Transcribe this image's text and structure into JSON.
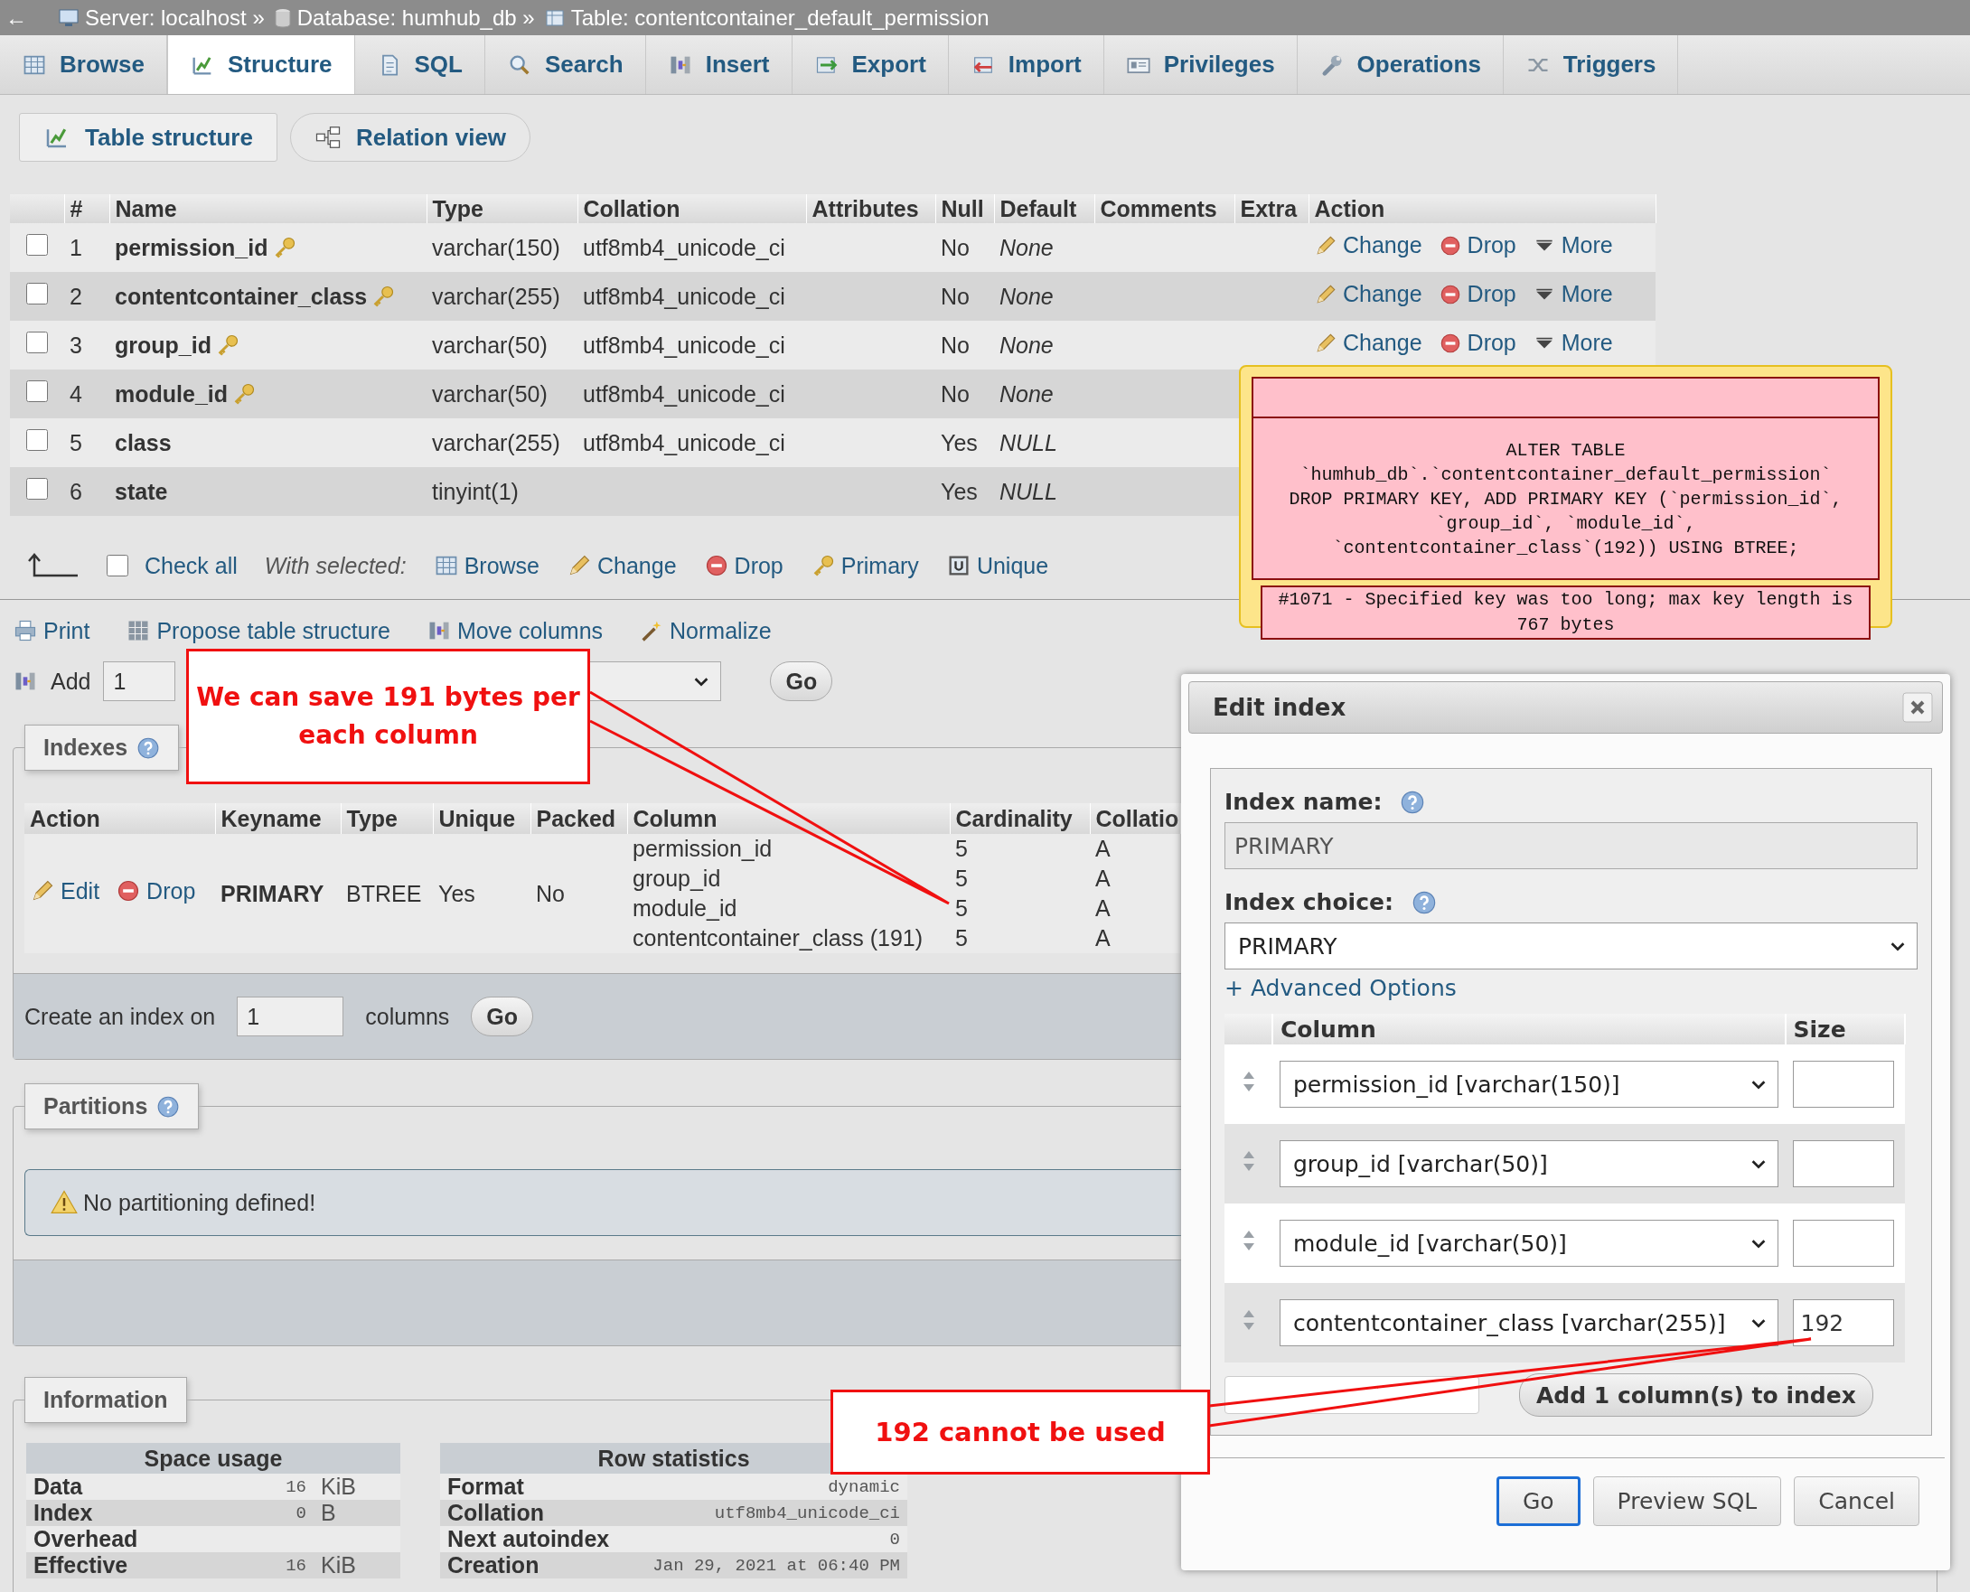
{
  "breadcrumb": {
    "back": "←",
    "items": [
      "Server: localhost »",
      "Database: humhub_db »",
      "Table: contentcontainer_default_permission"
    ]
  },
  "tabs": [
    {
      "label": "Browse",
      "selected": false
    },
    {
      "label": "Structure",
      "selected": true
    },
    {
      "label": "SQL",
      "selected": false
    },
    {
      "label": "Search",
      "selected": false
    },
    {
      "label": "Insert",
      "selected": false
    },
    {
      "label": "Export",
      "selected": false
    },
    {
      "label": "Import",
      "selected": false
    },
    {
      "label": "Privileges",
      "selected": false
    },
    {
      "label": "Operations",
      "selected": false
    },
    {
      "label": "Triggers",
      "selected": false
    }
  ],
  "subtabs": [
    {
      "label": "Table structure",
      "selected": true
    },
    {
      "label": "Relation view",
      "selected": false
    }
  ],
  "structure_table": {
    "headers": [
      "#",
      "Name",
      "Type",
      "Collation",
      "Attributes",
      "Null",
      "Default",
      "Comments",
      "Extra",
      "Action"
    ],
    "rows": [
      {
        "checked": false,
        "num": "1",
        "name": "permission_id",
        "primary_key": true,
        "type": "varchar(150)",
        "collation": "utf8mb4_unicode_ci",
        "null": "No",
        "default": "None",
        "actions": [
          "Change",
          "Drop",
          "More"
        ]
      },
      {
        "checked": false,
        "num": "2",
        "name": "contentcontainer_class",
        "primary_key": true,
        "type": "varchar(255)",
        "collation": "utf8mb4_unicode_ci",
        "null": "No",
        "default": "None",
        "actions": [
          "Change",
          "Drop",
          "More"
        ]
      },
      {
        "checked": false,
        "num": "3",
        "name": "group_id",
        "primary_key": true,
        "type": "varchar(50)",
        "collation": "utf8mb4_unicode_ci",
        "null": "No",
        "default": "None",
        "actions": [
          "Change",
          "Drop",
          "More"
        ]
      },
      {
        "checked": false,
        "num": "4",
        "name": "module_id",
        "primary_key": true,
        "type": "varchar(50)",
        "collation": "utf8mb4_unicode_ci",
        "null": "No",
        "default": "None"
      },
      {
        "checked": false,
        "num": "5",
        "name": "class",
        "primary_key": false,
        "type": "varchar(255)",
        "collation": "utf8mb4_unicode_ci",
        "null": "Yes",
        "default": "NULL"
      },
      {
        "checked": false,
        "num": "6",
        "name": "state",
        "primary_key": false,
        "type": "tinyint(1)",
        "null": "Yes",
        "default": "NULL"
      }
    ]
  },
  "bulk": {
    "check_all": {
      "label": "Check all",
      "checked": false
    },
    "with_selected": "With selected:",
    "actions": [
      "Browse",
      "Change",
      "Drop",
      "Primary",
      "Unique"
    ]
  },
  "toolbar": [
    "Print",
    "Propose table structure",
    "Move columns",
    "Normalize"
  ],
  "add_columns": {
    "label": "Add",
    "value": "1",
    "button": "Go"
  },
  "indexes": {
    "legend": "Indexes",
    "headers": [
      "Action",
      "Keyname",
      "Type",
      "Unique",
      "Packed",
      "Column",
      "Cardinality",
      "Collatio"
    ],
    "row": {
      "actions": [
        "Edit",
        "Drop"
      ],
      "keyname": "PRIMARY",
      "type": "BTREE",
      "unique": "Yes",
      "packed": "No",
      "columns": [
        {
          "column": "permission_id",
          "cardinality": "5",
          "collation": "A"
        },
        {
          "column": "group_id",
          "cardinality": "5",
          "collation": "A"
        },
        {
          "column": "module_id",
          "cardinality": "5",
          "collation": "A"
        },
        {
          "column": "contentcontainer_class (191)",
          "cardinality": "5",
          "collation": "A"
        }
      ]
    },
    "create": {
      "label": "Create an index on",
      "value": "1",
      "unit": "columns",
      "button": "Go"
    }
  },
  "partitions": {
    "legend": "Partitions",
    "message": "No partitioning defined!"
  },
  "information": {
    "legend": "Information",
    "space_usage": {
      "title": "Space usage",
      "rows": [
        {
          "label": "Data",
          "value": "16",
          "unit": "KiB"
        },
        {
          "label": "Index",
          "value": "0",
          "unit": "B"
        },
        {
          "label": "Overhead"
        },
        {
          "label": "Effective",
          "value": "16",
          "unit": "KiB"
        }
      ]
    },
    "row_statistics": {
      "title": "Row statistics",
      "rows": [
        {
          "label": "Format",
          "value": "dynamic"
        },
        {
          "label": "Collation",
          "value": "utf8mb4_unicode_ci"
        },
        {
          "label": "Next autoindex",
          "value": "0"
        },
        {
          "label": "Creation",
          "value": "Jan 29, 2021 at 06:40 PM"
        }
      ]
    }
  },
  "error_popup": {
    "query": "ALTER TABLE\n`humhub_db`.`contentcontainer_default_permission`\nDROP PRIMARY KEY, ADD PRIMARY KEY (`permission_id`,\n`group_id`, `module_id`,\n`contentcontainer_class`(192)) USING BTREE;",
    "message": "#1071 - Specified key was too long; max key length is 767 bytes"
  },
  "edit_index": {
    "title": "Edit index",
    "index_name": {
      "label": "Index name:",
      "value": "PRIMARY",
      "disabled": true
    },
    "index_choice": {
      "label": "Index choice:",
      "value": "PRIMARY"
    },
    "advanced": "+ Advanced Options",
    "headers": [
      "Column",
      "Size"
    ],
    "columns": [
      {
        "column": "permission_id [varchar(150)]"
      },
      {
        "column": "group_id [varchar(50)]"
      },
      {
        "column": "module_id [varchar(50)]"
      },
      {
        "column": "contentcontainer_class [varchar(255)]",
        "size": "192"
      }
    ],
    "add_button": "Add 1 column(s) to index",
    "buttons": [
      {
        "label": "Go",
        "focused": true
      },
      {
        "label": "Preview SQL",
        "focused": false
      },
      {
        "label": "Cancel",
        "focused": false
      }
    ]
  },
  "callouts": [
    {
      "text": "We can save 191 bytes per each column"
    },
    {
      "text": "192 cannot be used"
    }
  ]
}
